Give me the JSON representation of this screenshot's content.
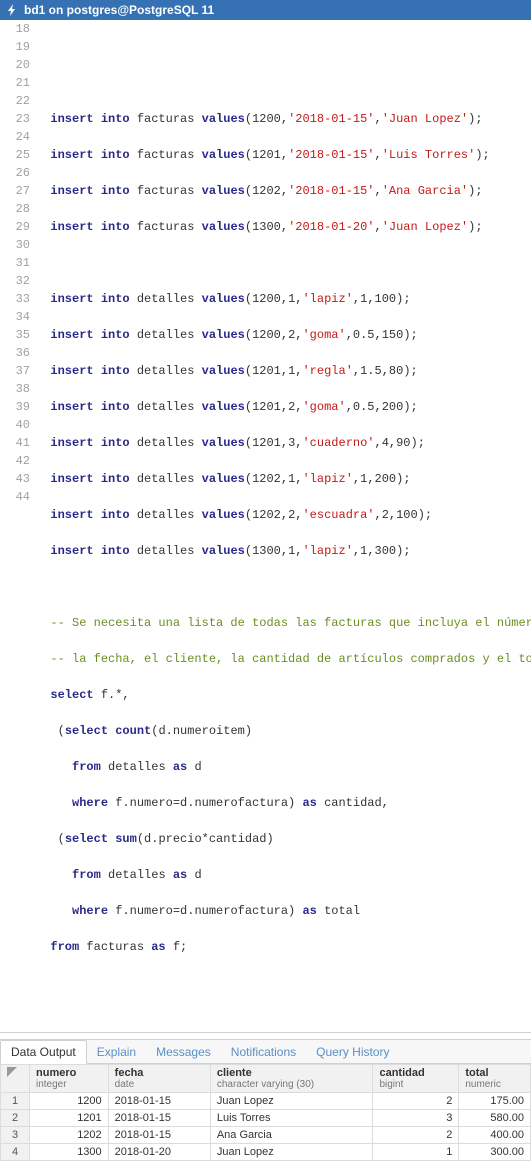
{
  "header": {
    "title": "bd1 on postgres@PostgreSQL 11"
  },
  "gutter": [
    "18",
    "19",
    "20",
    "21",
    "22",
    "23",
    "24",
    "25",
    "26",
    "27",
    "28",
    "29",
    "30",
    "31",
    "32",
    "33",
    "34",
    "35",
    "36",
    "37",
    "38",
    "39",
    "40",
    "41",
    "42",
    "43",
    "44"
  ],
  "tabs": {
    "data_output": "Data Output",
    "explain": "Explain",
    "messages": "Messages",
    "notifications": "Notifications",
    "query_history": "Query History"
  },
  "columns": [
    {
      "name": "numero",
      "type": "integer"
    },
    {
      "name": "fecha",
      "type": "date"
    },
    {
      "name": "cliente",
      "type": "character varying (30)"
    },
    {
      "name": "cantidad",
      "type": "bigint"
    },
    {
      "name": "total",
      "type": "numeric"
    }
  ],
  "rows": [
    {
      "n": "1",
      "numero": "1200",
      "fecha": "2018-01-15",
      "cliente": "Juan Lopez",
      "cantidad": "2",
      "total": "175.00"
    },
    {
      "n": "2",
      "numero": "1201",
      "fecha": "2018-01-15",
      "cliente": "Luis Torres",
      "cantidad": "3",
      "total": "580.00"
    },
    {
      "n": "3",
      "numero": "1202",
      "fecha": "2018-01-15",
      "cliente": "Ana Garcia",
      "cantidad": "2",
      "total": "400.00"
    },
    {
      "n": "4",
      "numero": "1300",
      "fecha": "2018-01-20",
      "cliente": "Juan Lopez",
      "cantidad": "1",
      "total": "300.00"
    }
  ],
  "sql": {
    "l18": "",
    "l19": "",
    "l20_a": "insert into",
    "l20_b": " facturas ",
    "l20_c": "values",
    "l20_d": "(",
    "l20_e": "1200",
    "l20_f": ",",
    "l20_g": "'2018-01-15'",
    "l20_h": ",",
    "l20_i": "'Juan Lopez'",
    "l20_j": ");",
    "l21_a": "insert into",
    "l21_b": " facturas ",
    "l21_c": "values",
    "l21_d": "(",
    "l21_e": "1201",
    "l21_f": ",",
    "l21_g": "'2018-01-15'",
    "l21_h": ",",
    "l21_i": "'Luis Torres'",
    "l21_j": ");",
    "l22_a": "insert into",
    "l22_b": " facturas ",
    "l22_c": "values",
    "l22_d": "(",
    "l22_e": "1202",
    "l22_f": ",",
    "l22_g": "'2018-01-15'",
    "l22_h": ",",
    "l22_i": "'Ana Garcia'",
    "l22_j": ");",
    "l23_a": "insert into",
    "l23_b": " facturas ",
    "l23_c": "values",
    "l23_d": "(",
    "l23_e": "1300",
    "l23_f": ",",
    "l23_g": "'2018-01-20'",
    "l23_h": ",",
    "l23_i": "'Juan Lopez'",
    "l23_j": ");",
    "l24": "",
    "l25_a": "insert into",
    "l25_b": " detalles ",
    "l25_c": "values",
    "l25_d": "(",
    "l25_e": "1200",
    "l25_f": ",",
    "l25_g": "1",
    "l25_h": ",",
    "l25_i": "'lapiz'",
    "l25_j": ",",
    "l25_k": "1",
    "l25_l": ",",
    "l25_m": "100",
    "l25_n": ");",
    "l26_a": "insert into",
    "l26_b": " detalles ",
    "l26_c": "values",
    "l26_d": "(",
    "l26_e": "1200",
    "l26_f": ",",
    "l26_g": "2",
    "l26_h": ",",
    "l26_i": "'goma'",
    "l26_j": ",",
    "l26_k": "0.5",
    "l26_l": ",",
    "l26_m": "150",
    "l26_n": ");",
    "l27_a": "insert into",
    "l27_b": " detalles ",
    "l27_c": "values",
    "l27_d": "(",
    "l27_e": "1201",
    "l27_f": ",",
    "l27_g": "1",
    "l27_h": ",",
    "l27_i": "'regla'",
    "l27_j": ",",
    "l27_k": "1.5",
    "l27_l": ",",
    "l27_m": "80",
    "l27_n": ");",
    "l28_a": "insert into",
    "l28_b": " detalles ",
    "l28_c": "values",
    "l28_d": "(",
    "l28_e": "1201",
    "l28_f": ",",
    "l28_g": "2",
    "l28_h": ",",
    "l28_i": "'goma'",
    "l28_j": ",",
    "l28_k": "0.5",
    "l28_l": ",",
    "l28_m": "200",
    "l28_n": ");",
    "l29_a": "insert into",
    "l29_b": " detalles ",
    "l29_c": "values",
    "l29_d": "(",
    "l29_e": "1201",
    "l29_f": ",",
    "l29_g": "3",
    "l29_h": ",",
    "l29_i": "'cuaderno'",
    "l29_j": ",",
    "l29_k": "4",
    "l29_l": ",",
    "l29_m": "90",
    "l29_n": ");",
    "l30_a": "insert into",
    "l30_b": " detalles ",
    "l30_c": "values",
    "l30_d": "(",
    "l30_e": "1202",
    "l30_f": ",",
    "l30_g": "1",
    "l30_h": ",",
    "l30_i": "'lapiz'",
    "l30_j": ",",
    "l30_k": "1",
    "l30_l": ",",
    "l30_m": "200",
    "l30_n": ");",
    "l31_a": "insert into",
    "l31_b": " detalles ",
    "l31_c": "values",
    "l31_d": "(",
    "l31_e": "1202",
    "l31_f": ",",
    "l31_g": "2",
    "l31_h": ",",
    "l31_i": "'escuadra'",
    "l31_j": ",",
    "l31_k": "2",
    "l31_l": ",",
    "l31_m": "100",
    "l31_n": ");",
    "l32_a": "insert into",
    "l32_b": " detalles ",
    "l32_c": "values",
    "l32_d": "(",
    "l32_e": "1300",
    "l32_f": ",",
    "l32_g": "1",
    "l32_h": ",",
    "l32_i": "'lapiz'",
    "l32_j": ",",
    "l32_k": "1",
    "l32_l": ",",
    "l32_m": "300",
    "l32_n": ");",
    "l33": "",
    "l34": "-- Se necesita una lista de todas las facturas que incluya el número,",
    "l35": "-- la fecha, el cliente, la cantidad de artículos comprados y el total:",
    "l36_a": "select",
    "l36_b": " f.*,",
    "l37_a": " (",
    "l37_b": "select",
    "l37_c": " ",
    "l37_d": "count",
    "l37_e": "(d.numeroitem)",
    "l38_a": "   ",
    "l38_b": "from",
    "l38_c": " detalles ",
    "l38_d": "as",
    "l38_e": " d",
    "l39_a": "   ",
    "l39_b": "where",
    "l39_c": " f.numero=d.numerofactura) ",
    "l39_d": "as",
    "l39_e": " cantidad,",
    "l40_a": " (",
    "l40_b": "select",
    "l40_c": " ",
    "l40_d": "sum",
    "l40_e": "(d.precio*cantidad)",
    "l41_a": "   ",
    "l41_b": "from",
    "l41_c": " detalles ",
    "l41_d": "as",
    "l41_e": " d",
    "l42_a": "   ",
    "l42_b": "where",
    "l42_c": " f.numero=d.numerofactura) ",
    "l42_d": "as",
    "l42_e": " total",
    "l43_a": "from",
    "l43_b": " facturas ",
    "l43_c": "as",
    "l43_d": " f;",
    "l44": ""
  }
}
